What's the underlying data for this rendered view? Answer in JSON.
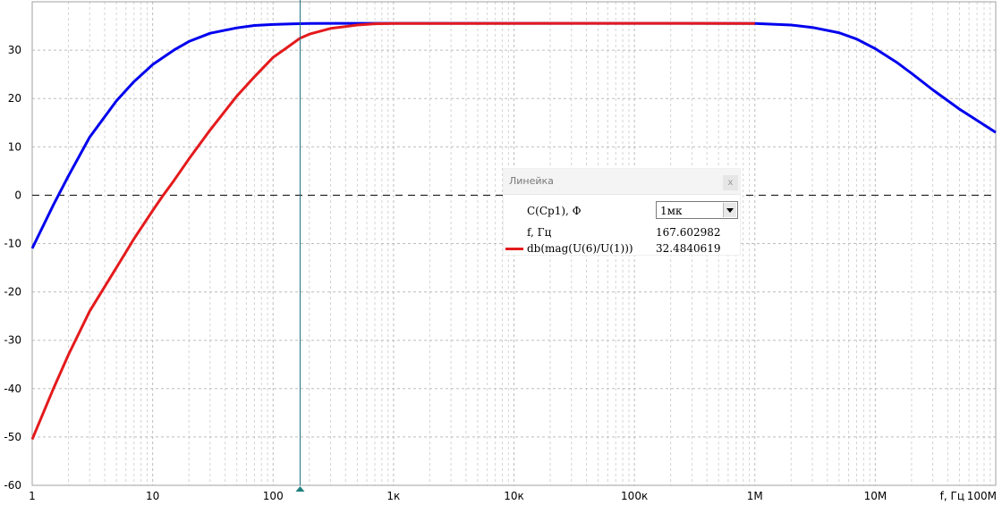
{
  "chart_data": {
    "type": "line",
    "x_scale": "log",
    "xlim": [
      1,
      100000000
    ],
    "ylim": [
      -60,
      40
    ],
    "grid": true,
    "x_tick_values": [
      1,
      10,
      100,
      1000,
      10000,
      100000,
      1000000,
      10000000,
      100000000
    ],
    "x_tick_labels": [
      "1",
      "10",
      "100",
      "1к",
      "10к",
      "100к",
      "1M",
      "10M",
      "100M"
    ],
    "x_unit_label": "f, Гц",
    "y_ticks": [
      -60,
      -50,
      -40,
      -30,
      -20,
      -10,
      0,
      10,
      20,
      30
    ],
    "cursor_x": 167.602982,
    "series": [
      {
        "color": "#0000ee",
        "points": [
          [
            1,
            -11
          ],
          [
            1.5,
            -2
          ],
          [
            2,
            4
          ],
          [
            3,
            12
          ],
          [
            5,
            19.5
          ],
          [
            7,
            23.5
          ],
          [
            10,
            27
          ],
          [
            15,
            30
          ],
          [
            20,
            31.8
          ],
          [
            30,
            33.5
          ],
          [
            50,
            34.6
          ],
          [
            70,
            35.1
          ],
          [
            100,
            35.3
          ],
          [
            150,
            35.45
          ],
          [
            200,
            35.5
          ],
          [
            500,
            35.55
          ],
          [
            1000,
            35.55
          ],
          [
            100000,
            35.55
          ],
          [
            1000000,
            35.5
          ],
          [
            2000000,
            35.2
          ],
          [
            3000000,
            34.7
          ],
          [
            5000000,
            33.6
          ],
          [
            7000000,
            32.3
          ],
          [
            10000000,
            30.3
          ],
          [
            15000000,
            27.5
          ],
          [
            20000000,
            25.2
          ],
          [
            30000000,
            21.8
          ],
          [
            50000000,
            17.8
          ],
          [
            100000000,
            13
          ]
        ]
      },
      {
        "name": "db(mag(U(6)/U(1)))",
        "color": "#e41a1c",
        "points": [
          [
            1,
            -50.5
          ],
          [
            1.5,
            -40
          ],
          [
            2,
            -33
          ],
          [
            3,
            -24
          ],
          [
            5,
            -15
          ],
          [
            7,
            -9
          ],
          [
            10,
            -3.2
          ],
          [
            12,
            -0.3
          ],
          [
            15,
            3
          ],
          [
            20,
            7.5
          ],
          [
            30,
            13.5
          ],
          [
            50,
            20.5
          ],
          [
            70,
            24.5
          ],
          [
            100,
            28.5
          ],
          [
            130,
            30.5
          ],
          [
            167.6,
            32.48
          ],
          [
            200,
            33.3
          ],
          [
            300,
            34.5
          ],
          [
            500,
            35.2
          ],
          [
            700,
            35.45
          ],
          [
            1000,
            35.5
          ],
          [
            100000,
            35.55
          ],
          [
            1000000,
            35.5
          ]
        ]
      }
    ]
  },
  "legend": {
    "title": "Линейка",
    "close": "x",
    "param_label": "C(Cp1), Ф",
    "param_value": "1мк",
    "f_label": "f, Гц",
    "f_value": "167.602982",
    "series_label": "db(mag(U(6)/U(1)))",
    "series_value": "32.4840619"
  }
}
